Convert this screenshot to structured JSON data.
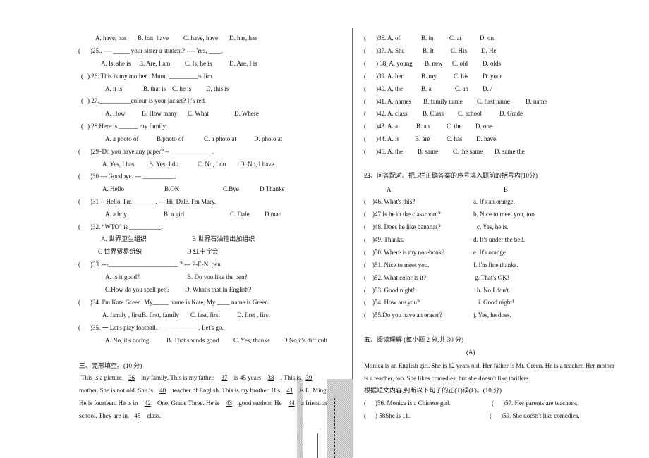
{
  "left_column": {
    "q24_options": [
      "A. have, has",
      "B. has, have",
      "C. have, have",
      "D. has, has"
    ],
    "questions": [
      {
        "num": ")25.. ---- _____ your sister a student?      ---- Yes, ____.",
        "options": [
          "A. Is, she is",
          "B. Are, I am",
          "C. Is, he is",
          "D. Are, I is"
        ]
      },
      {
        "num": ")  26. This is my mother . Mum,  _________is Jim.",
        "options": [
          "A. it is",
          "B. that is",
          "C. he is",
          "D. this is"
        ]
      },
      {
        "num": ")  27.__________colour is your jacket?     It's red.",
        "options": [
          "A. How",
          "B. How many",
          "C. What",
          "D. Where"
        ]
      },
      {
        "num": ")  28.Here is ______ my family.",
        "options": [
          "A. a photo of",
          "B.photo of",
          "C. a photo at",
          "D. photo at"
        ]
      },
      {
        "num": ")29–Do you have any paper? -- _____________.",
        "options": [
          "A. Yes, I has",
          "B. Yes, I do",
          "C. No, I do",
          "D. No, I have"
        ]
      },
      {
        "num": ")30 --- Goodbye.        ---     __________.",
        "options": [
          "A. Hello",
          "B.OK",
          "C.Bye",
          "D Thanks"
        ]
      },
      {
        "num": ")31 -- Hello, I'm_______   . --- Hi, Dale. I'm Mary.",
        "options": [
          "A. a boy",
          "B. a girl",
          "C. Dale",
          "D    man"
        ]
      },
      {
        "num": ")32. “WTO” is __________.",
        "options": [
          "A.  世界卫生组织",
          "B 世界石油输出加组织",
          "C 世界贸易组织",
          "D  红十字会"
        ]
      },
      {
        "num": ")33 .---______________________  ?     ---   P-E-N. pen",
        "options": [
          "A.   Is it good?",
          "B. Do you like the pen?",
          "C.How do you spell pen?",
          "D. What's that in English?"
        ]
      },
      {
        "num": ")34. I'm Kate Green. My_____ name is Kate, My ____ name is Green.",
        "options": [
          "A. family , first",
          "B. first, family",
          "C. last, first",
          "D. first , first"
        ]
      },
      {
        "num": ")35.  一 Let's play football. — __________. Let's go.",
        "options": [
          "A. No, it's boring",
          "B. That sounds good",
          "C. Yes, thanks",
          "D No,it's difficult"
        ]
      }
    ],
    "paren_open": "(",
    "cloze": {
      "heading": "三、完形填空。(10 分)",
      "lines": [
        [
          "This is a picture ",
          "36",
          " my family. This is my father. ",
          "37",
          " is 45 years ",
          "38",
          " . This is",
          "39"
        ],
        [
          "mother. She is not old. She is ",
          "40",
          " teacher of English. This is my brother. His ",
          "41",
          " is Li Ming."
        ],
        [
          "He is fourteen. He is in ",
          "42",
          " One, Grade Three. He is ",
          "43",
          " good student. He ",
          "44",
          " a friend at"
        ],
        [
          "school. They are in ",
          "45",
          " class."
        ]
      ]
    }
  },
  "right_column": {
    "cloze_options": [
      {
        "num": ")36. A. of",
        "options": [
          "B. in",
          "C. at",
          "D. on"
        ]
      },
      {
        "num": ")37. A. She",
        "options": [
          "B. It",
          "C. His",
          "D. He"
        ]
      },
      {
        "num": ") 38. A. young",
        "options": [
          "B. new",
          "C. old",
          "D. olds"
        ]
      },
      {
        "num": ")39. A. her",
        "options": [
          "B. my",
          "C. his",
          "D. your"
        ]
      },
      {
        "num": ")40. A. the",
        "options": [
          "B. a",
          "C. an",
          "D. /"
        ]
      },
      {
        "num": ")41. A. names",
        "options": [
          "B. family name",
          "C. first name",
          "D. name"
        ]
      },
      {
        "num": ")42. A. class",
        "options": [
          "B. Class",
          "C. school",
          "D. Grade"
        ]
      },
      {
        "num": ")43. A. a",
        "options": [
          "B. an",
          "C. the",
          "D. one"
        ]
      },
      {
        "num": ")44. A. is",
        "options": [
          "B. are",
          "C. has",
          "D. have"
        ]
      },
      {
        "num": ")45. A. the",
        "options": [
          "B. same",
          "C. the same",
          "D. same the"
        ]
      }
    ],
    "matching": {
      "heading": "四、问答配对。把B栏正确答案的序号填入题前的括号内(10分)",
      "col_a": "A",
      "col_b": "B",
      "rows": [
        {
          "q": ")46. What's this?",
          "a": "a. It's an orange."
        },
        {
          "q": ")47    Is he in the classroom?",
          "a": "b. Nice to meet you, too."
        },
        {
          "q": ")48. Does he like bananas?",
          "a": "c. Yes, he is."
        },
        {
          "q": ")49. Thanks.",
          "a": "d. It's under the bed."
        },
        {
          "q": ")50. Where is my notebook?",
          "a": "e. It's orange."
        },
        {
          "q": ")51. Nice to meet you.",
          "a": "f. I'm fine,thanks."
        },
        {
          "q": ")52. What color is it?",
          "a": "g. That's OK!"
        },
        {
          "q": ")53. Good night!",
          "a": "h. No,I don't."
        },
        {
          "q": ")54. How are you?",
          "a": "i. Good night!"
        },
        {
          "q": ")55.Do you have an eraser?",
          "a": "j. Yes, he does."
        }
      ]
    },
    "reading": {
      "heading": "五、阅读理解      (每小题 2 分,共 30 分)",
      "sub": "(A)",
      "passage_line1": "Monica is an English girl. She is 12 years old. Her father is Mr. Green. He is a teacher. Her mother",
      "passage_line2": "is a teacher, too. She likes comedies, but she doesn't like thrillers.",
      "instruction": "根据短文内容,判断以下句子的正(T)误(F)。(10 分)",
      "tf": [
        {
          "q": ")56. Monica is a Chinese girl."
        },
        {
          "q": ")57. Her parents are teachers."
        },
        {
          "q": ") 58She is 11."
        },
        {
          "q": ")59. She doesn't like comedies."
        }
      ]
    }
  }
}
